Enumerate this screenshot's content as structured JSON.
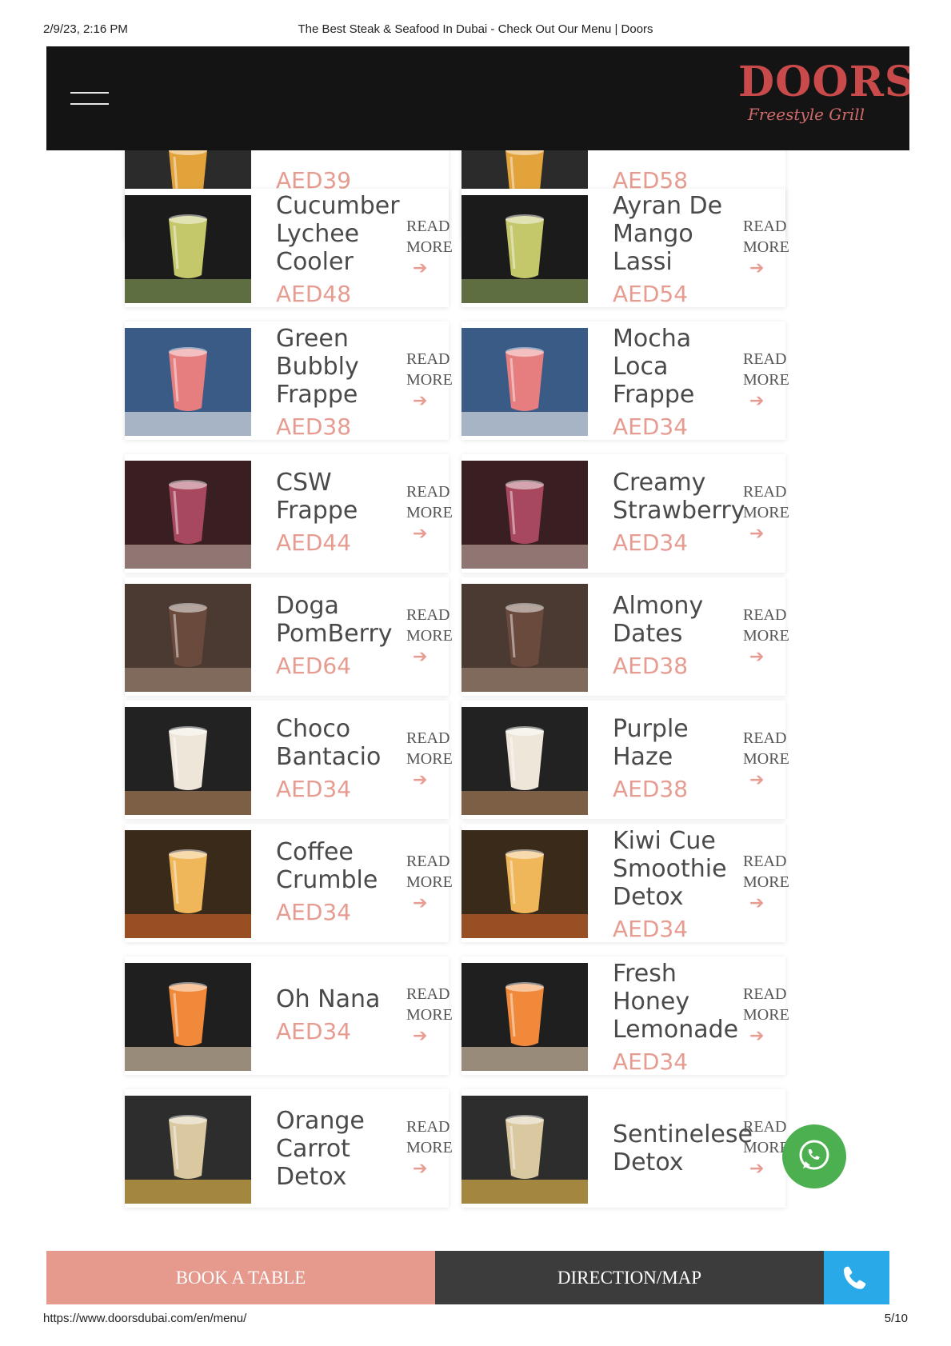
{
  "print": {
    "datetime": "2/9/23, 2:16 PM",
    "page_title": "The Best Steak & Seafood In Dubai - Check Out Our Menu | Doors",
    "url": "https://www.doorsdubai.com/en/menu/",
    "page_number": "5/10"
  },
  "brand": {
    "logo_main": "DOORS",
    "logo_sub": "Freestyle Grill",
    "accent_color": "#e69c90",
    "header_bg": "#141414"
  },
  "read_more_line1": "READ",
  "read_more_line2": "MORE",
  "arrow_glyph": "➔",
  "left_items": [
    {
      "name": "",
      "price": "AED39"
    },
    {
      "name": "Cucumber\nLychee\nCooler",
      "price": "AED48"
    },
    {
      "name": "Green\nBubbly\nFrappe",
      "price": "AED38"
    },
    {
      "name": "CSW\nFrappe",
      "price": "AED44"
    },
    {
      "name": "Doga\nPomBerry",
      "price": "AED64"
    },
    {
      "name": "Choco\nBantacio",
      "price": "AED34"
    },
    {
      "name": "Coffee\nCrumble",
      "price": "AED34"
    },
    {
      "name": "Oh Nana",
      "price": "AED34"
    },
    {
      "name": "Orange\nCarrot\nDetox",
      "price": ""
    }
  ],
  "right_items": [
    {
      "name": "",
      "price": "AED58"
    },
    {
      "name": "Ayran De\nMango\nLassi",
      "price": "AED54"
    },
    {
      "name": "Mocha\nLoca\nFrappe",
      "price": "AED34"
    },
    {
      "name": "Creamy\nStrawberry",
      "price": "AED34"
    },
    {
      "name": "Almony\nDates",
      "price": "AED38"
    },
    {
      "name": "Purple\nHaze",
      "price": "AED38"
    },
    {
      "name": "Kiwi Cue\nSmoothie\nDetox",
      "price": "AED34"
    },
    {
      "name": "Fresh\nHoney\nLemonade",
      "price": "AED34"
    },
    {
      "name": "Sentinelese\nDetox",
      "price": ""
    }
  ],
  "bottom_bar": {
    "book": "BOOK A TABLE",
    "direction": "DIRECTION/MAP"
  },
  "icons": {
    "menu": "hamburger-icon",
    "whatsapp": "whatsapp-icon",
    "phone": "phone-icon"
  }
}
